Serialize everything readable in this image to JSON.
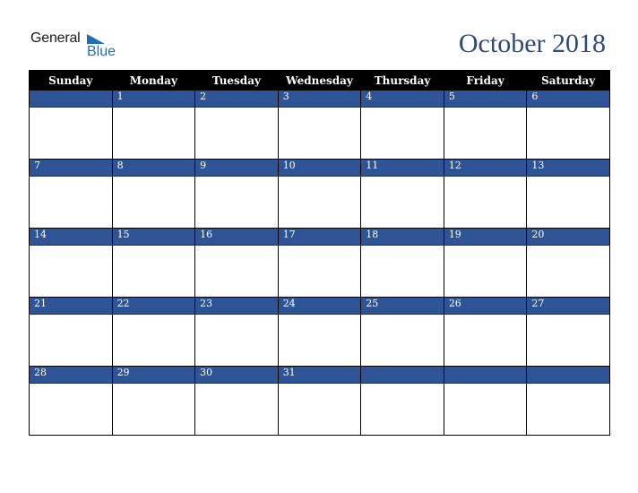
{
  "logo": {
    "line1": "General",
    "line2": "Blue"
  },
  "title": "October 2018",
  "colors": {
    "band": "#2e5496",
    "header": "#000000",
    "title": "#2e4a7a",
    "logo_blue": "#1f6fb5"
  },
  "weekdays": [
    "Sunday",
    "Monday",
    "Tuesday",
    "Wednesday",
    "Thursday",
    "Friday",
    "Saturday"
  ],
  "weeks": [
    [
      "",
      "1",
      "2",
      "3",
      "4",
      "5",
      "6"
    ],
    [
      "7",
      "8",
      "9",
      "10",
      "11",
      "12",
      "13"
    ],
    [
      "14",
      "15",
      "16",
      "17",
      "18",
      "19",
      "20"
    ],
    [
      "21",
      "22",
      "23",
      "24",
      "25",
      "26",
      "27"
    ],
    [
      "28",
      "29",
      "30",
      "31",
      "",
      "",
      ""
    ]
  ]
}
